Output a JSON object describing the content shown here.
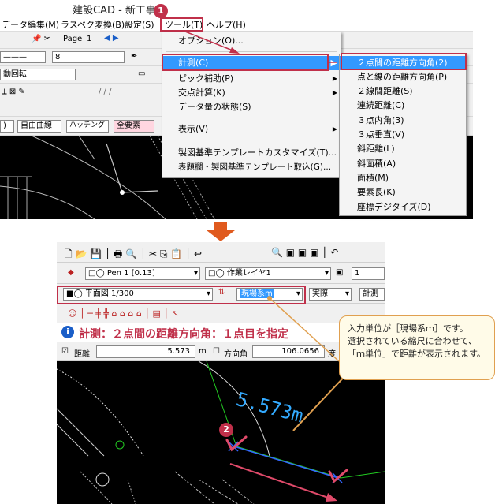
{
  "top_app": {
    "title": "建設CAD - 新工事",
    "menus": [
      "データ編集(M)",
      "ラスベク変換(B)",
      "設定(S)",
      "ツール(T)",
      "ヘルプ(H)"
    ],
    "page_label": "Page",
    "page_number": "1",
    "line_width_value": "8",
    "rotation_label": "動回転",
    "buttons": [
      "自由曲線",
      "ハッチング",
      "全要素"
    ],
    "tools_menu": [
      "オプション(O)...",
      "計測(C)",
      "ピック補助(P)",
      "交点計算(K)",
      "データ量の状態(S)",
      "表示(V)",
      "製図基準テンプレートカスタマイズ(T)...",
      "表題欄・製図基準テンプレート取込(G)..."
    ],
    "measure_submenu": [
      "２点間の距離方向角(2)",
      "点と線の距離方向角(P)",
      "２線間距離(S)",
      "連続距離(C)",
      "３点内角(3)",
      "３点垂直(V)",
      "斜距離(L)",
      "斜面積(A)",
      "面積(M)",
      "要素長(K)",
      "座標デジタイズ(D)"
    ]
  },
  "bottom_app": {
    "pen_select": "Pen 1 [0.13]",
    "layer_select": "作業レイヤ1",
    "layer_number": "1",
    "scale_select": "平面図 1/300",
    "unit_select": "現場系m",
    "actual_select": "実際",
    "calc_button": "計測",
    "status_message": "計測：２点間の距離方向角：１点目を指定",
    "distance_label": "距離",
    "distance_value": "5.573",
    "distance_unit": "m",
    "angle_label": "方向角",
    "angle_value": "106.0656",
    "angle_unit": "度",
    "canvas_readout": "5.573m"
  },
  "callout": {
    "lines": [
      "入力単位が［現場系ｍ］です。",
      "選択されている縮尺に合わせて、",
      "「ｍ単位」で距離が表示されます。"
    ]
  },
  "badges": [
    "1",
    "2"
  ],
  "colors": {
    "highlight": "#c0304a",
    "menu_select": "#3399ff",
    "arrow": "#e05a1e",
    "canvas": "#000000",
    "readout": "#33aaff"
  }
}
